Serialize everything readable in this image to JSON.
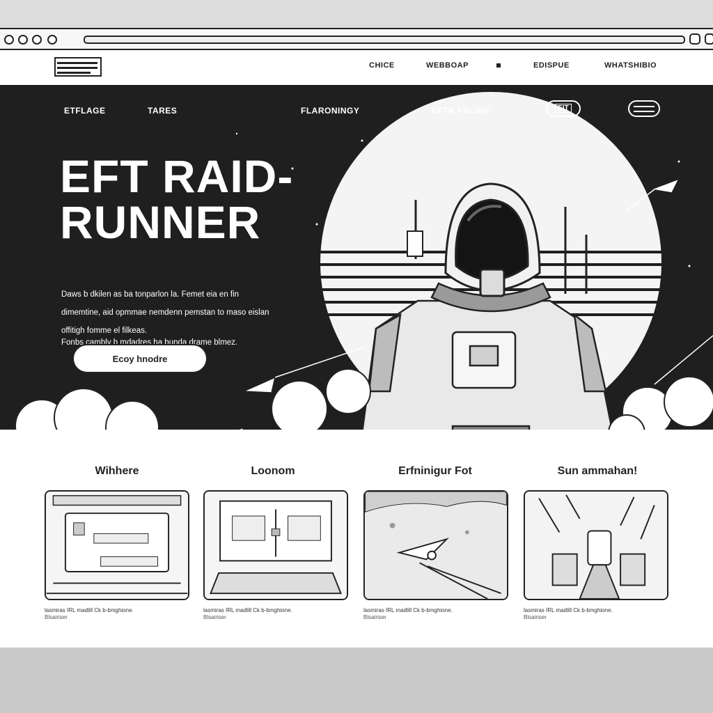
{
  "topnav": {
    "links": [
      "CHICE",
      "WEBBOAP",
      "EDISPUE",
      "WHATSHIBIO"
    ]
  },
  "hero": {
    "nav": [
      "ETFLAGE",
      "TARES",
      "FLARONINGY",
      "EFTR FBLIBP'"
    ],
    "pill_label": "EIT",
    "title_line1": "EFT RAID-",
    "title_line2": "RUNNER",
    "description": "Daws b dkilen as ba tonparlon la. Femet eia en fin dimemtine, aid opmmae nemdenn pemstan to maso eislan offitigh fomme el filkeas.",
    "sub_description": "Fonbs cambly b mdadres ha bunda drame blmez.",
    "cta_label": "Ecoy hnodre"
  },
  "features": [
    {
      "title": "Wihhere",
      "caption": "lasmiras IRL madlill Ck b-bmghione.",
      "sub": "Blsairiser"
    },
    {
      "title": "Loonom",
      "caption": "lasmiras IRL madlill Ck b-bmghione.",
      "sub": "Blsairiser"
    },
    {
      "title": "Erfninigur Fot",
      "caption": "lasmiras IRL madlill Ck b-bmghione.",
      "sub": "Blsairiser"
    },
    {
      "title": "Sun ammahan!",
      "caption": "lasmiras IRL madlill Ck b-bmghione.",
      "sub": "Blsairiser"
    }
  ],
  "colors": {
    "dark": "#1f1f1f",
    "light": "#ffffff",
    "ink": "#222222"
  },
  "icons": [
    "menu-icon",
    "hamburger-icon"
  ]
}
